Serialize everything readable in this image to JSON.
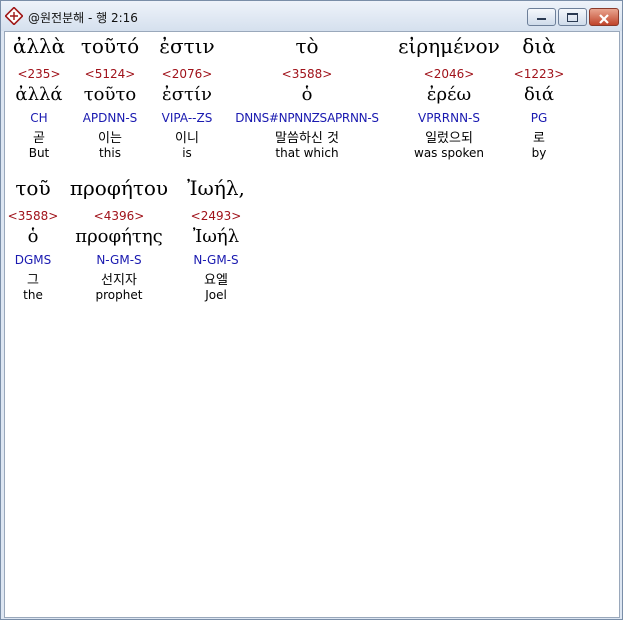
{
  "window": {
    "title": "@원전분해 - 행 2:16",
    "icon": "app-icon",
    "controls": [
      "minimize",
      "maximize",
      "close"
    ]
  },
  "colors": {
    "strong": "#a0121a",
    "parse": "#1a1ab0",
    "selected_bg": "#ffffff"
  },
  "words": [
    {
      "greek": "ἀλλὰ",
      "strong": "<235>",
      "lemma": "ἀλλά",
      "parse": "CH",
      "korean": "곧",
      "english": "But"
    },
    {
      "greek": "τοῦτό",
      "strong": "<5124>",
      "lemma": "τοῦτο",
      "parse": "APDNN-S",
      "korean": "이는",
      "english": "this"
    },
    {
      "greek": "ἐστιν",
      "strong": "<2076>",
      "lemma": "ἐστίν",
      "parse": "VIPA--ZS",
      "korean": "이니",
      "english": "is"
    },
    {
      "greek": "τὸ",
      "strong": "<3588>",
      "lemma": "ὁ",
      "parse": "DNNS#NPNNZSAPRNN-S",
      "korean": "말씀하신 것",
      "english": "that which"
    },
    {
      "greek": "εἰρημένον",
      "strong": "<2046>",
      "lemma": "ἐρέω",
      "parse": "VPRRNN-S",
      "korean": "일렀으되",
      "english": "was spoken"
    },
    {
      "greek": "διὰ",
      "strong": "<1223>",
      "lemma": "διά",
      "parse": "PG",
      "korean": "로",
      "english": "by"
    },
    {
      "greek": "τοῦ",
      "strong": "<3588>",
      "lemma": "ὁ",
      "parse": "DGMS",
      "korean": "그",
      "english": "the"
    },
    {
      "greek": "προφήτου",
      "strong": "<4396>",
      "lemma": "προφήτης",
      "parse": "N-GM-S",
      "korean": "선지자",
      "english": "prophet"
    },
    {
      "greek": "Ἰωήλ,",
      "strong": "<2493>",
      "lemma": "Ἰωήλ",
      "parse": "N-GM-S",
      "korean": "요엘",
      "english": "Joel"
    }
  ]
}
